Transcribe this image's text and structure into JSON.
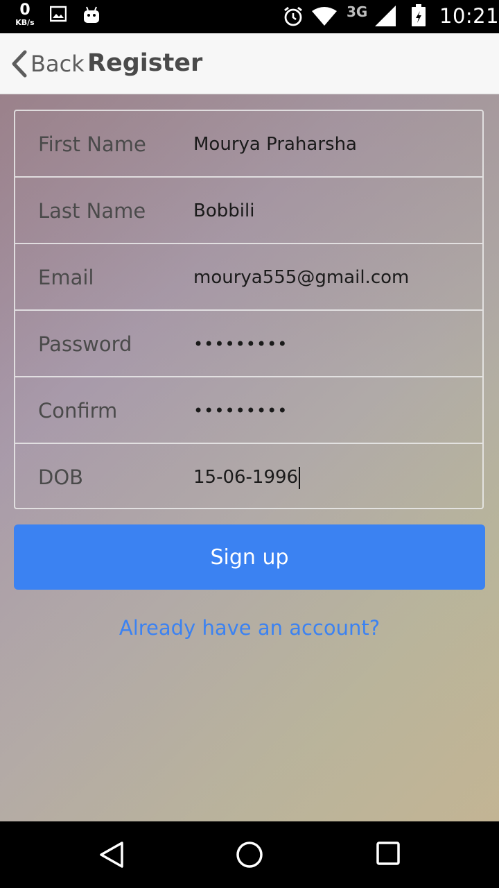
{
  "status_bar": {
    "kb_value": "0",
    "kb_unit": "KB/s",
    "network": "3G",
    "time": "10:21",
    "icons": [
      "image-icon",
      "android-icon",
      "alarm-icon",
      "wifi-icon",
      "signal-icon",
      "battery-icon"
    ]
  },
  "nav": {
    "back_label": "Back",
    "title": "Register"
  },
  "form": {
    "fields": [
      {
        "label": "First Name",
        "value": "Mourya Praharsha"
      },
      {
        "label": "Last Name",
        "value": "Bobbili"
      },
      {
        "label": "Email",
        "value": "mourya555@gmail.com"
      },
      {
        "label": "Password",
        "value": "•••••••••"
      },
      {
        "label": "Confirm",
        "value": "•••••••••"
      },
      {
        "label": "DOB",
        "value": "15-06-1996"
      }
    ]
  },
  "signup_label": "Sign up",
  "login_link_label": "Already have an account?",
  "colors": {
    "accent": "#3b82f2",
    "navbar_bg": "#f7f7f7"
  },
  "system_nav": [
    "back-triangle-icon",
    "home-circle-icon",
    "recents-square-icon"
  ]
}
